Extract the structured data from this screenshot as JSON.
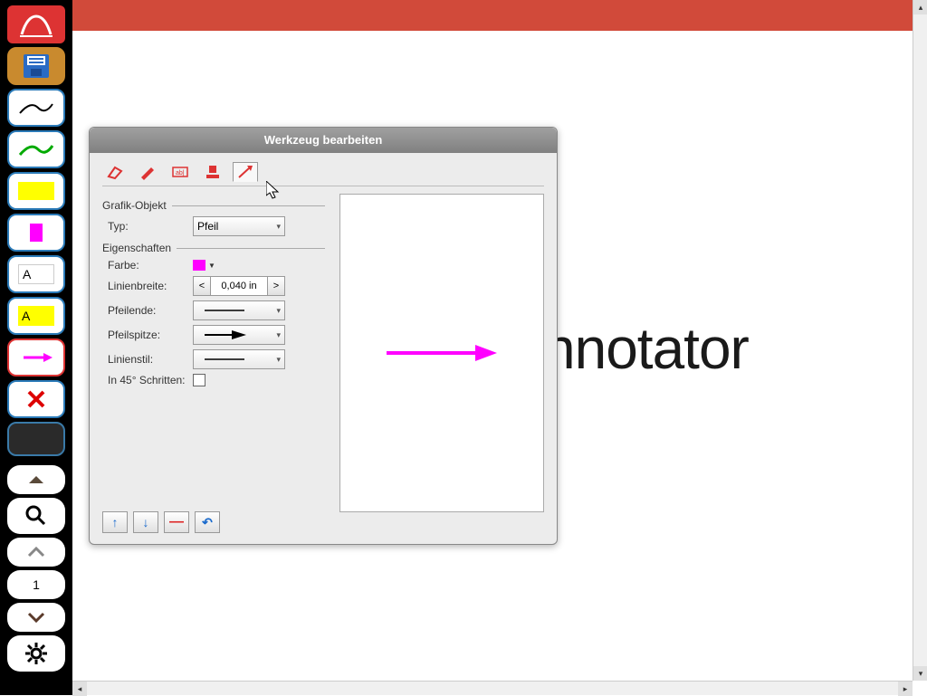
{
  "dialog": {
    "title": "Werkzeug bearbeiten",
    "sections": {
      "graphic_object": "Grafik-Objekt",
      "properties": "Eigenschaften"
    },
    "labels": {
      "type": "Typ:",
      "color": "Farbe:",
      "line_width": "Linienbreite:",
      "arrow_end": "Pfeilende:",
      "arrow_tip": "Pfeilspitze:",
      "line_style": "Linienstil:",
      "snap_45": "In 45° Schritten:"
    },
    "values": {
      "type": "Pfeil",
      "color": "#ff00ff",
      "line_width": "0,040 in",
      "snap_45": false
    },
    "spinner": {
      "dec": "<",
      "inc": ">"
    }
  },
  "canvas": {
    "background_text": "nnotator"
  },
  "sidebar": {
    "page_number": "1"
  },
  "toolbar_tabs": {
    "eraser": "eraser-icon",
    "pencil": "pencil-icon",
    "textbox": "textbox-icon",
    "stamp": "stamp-icon",
    "arrow": "arrow-icon"
  }
}
